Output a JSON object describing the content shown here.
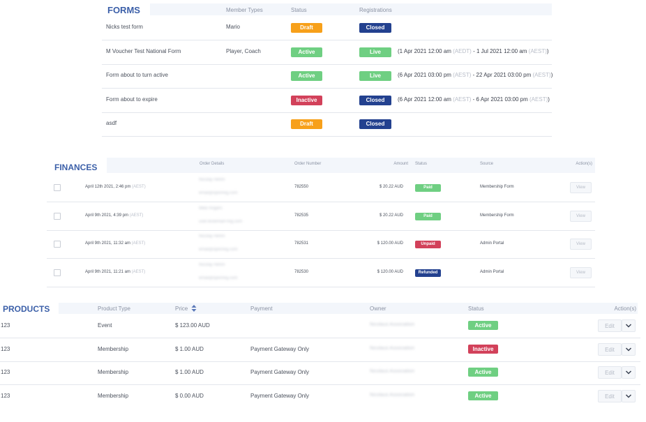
{
  "colors": {
    "accent": "#3b5fa8",
    "orange": "#f7a01a",
    "green": "#6fcf82",
    "red": "#d2415a",
    "navy": "#23418f"
  },
  "forms": {
    "title": "FORMS",
    "headers": {
      "member_types": "Member Types",
      "status": "Status",
      "registrations": "Registrations"
    },
    "rows": [
      {
        "name": "Nicks test form",
        "member_types": "Mario",
        "status": "Draft",
        "registration": "Closed",
        "range_start": "",
        "range_tz1": "",
        "range_mid": "",
        "range_tz2": "",
        "range_end": ""
      },
      {
        "name": "M Voucher Test National Form",
        "member_types": "Player, Coach",
        "status": "Active",
        "registration": "Live",
        "range_start": "(1 Apr 2021 12:00 am ",
        "range_tz1": "(AEDT)",
        "range_mid": " - 1 Jul 2021 12:00 am ",
        "range_tz2": "(AEST)",
        "range_end": ")"
      },
      {
        "name": "Form about to turn active",
        "member_types": "",
        "status": "Active",
        "registration": "Live",
        "range_start": "(6 Apr 2021 03:00 pm ",
        "range_tz1": "(AEST)",
        "range_mid": " - 22 Apr 2021 03:00 pm ",
        "range_tz2": "(AEST)",
        "range_end": ")"
      },
      {
        "name": "Form about to expire",
        "member_types": "",
        "status": "Inactive",
        "registration": "Closed",
        "range_start": "(6 Apr 2021 12:00 am ",
        "range_tz1": "(AEST)",
        "range_mid": " - 6 Apr 2021 03:00 pm ",
        "range_tz2": "(AEST)",
        "range_end": ")"
      },
      {
        "name": "asdf",
        "member_types": "",
        "status": "Draft",
        "registration": "Closed",
        "range_start": "",
        "range_tz1": "",
        "range_mid": "",
        "range_tz2": "",
        "range_end": ""
      }
    ]
  },
  "finances": {
    "title": "FINANCES",
    "headers": {
      "order_details": "Order Details",
      "order_number": "Order Number",
      "amount": "Amount",
      "status": "Status",
      "source": "Source",
      "actions": "Action(s)"
    },
    "view_label": "View",
    "rows": [
      {
        "date": "April 12th 2021, 2:46 pm ",
        "tz": "(AEST)",
        "detail_name": "Nicolay Hehm",
        "detail_email": "email@openreg.com",
        "order_number": "782550",
        "amount": "$ 20.22 AUD",
        "status": "Paid",
        "source": "Membership Form"
      },
      {
        "date": "April 9th 2021, 4:39 pm ",
        "tz": "(AEST)",
        "detail_name": "Mike Rogers",
        "detail_email": "user.testemail+reg.com",
        "order_number": "782535",
        "amount": "$ 20.22 AUD",
        "status": "Paid",
        "source": "Membership Form"
      },
      {
        "date": "April 9th 2021, 11:32 am ",
        "tz": "(AEST)",
        "detail_name": "Nicolay Hehm",
        "detail_email": "email@openreg.com",
        "order_number": "782531",
        "amount": "$ 120.00 AUD",
        "status": "Unpaid",
        "source": "Admin Portal"
      },
      {
        "date": "April 9th 2021, 11:21 am ",
        "tz": "(AEST)",
        "detail_name": "Nicolay Hehm",
        "detail_email": "email@openreg.com",
        "order_number": "782530",
        "amount": "$ 120.00 AUD",
        "status": "Refunded",
        "source": "Admin Portal"
      }
    ]
  },
  "products": {
    "title": "PRODUCTS",
    "headers": {
      "product_type": "Product Type",
      "price": "Price",
      "payment": "Payment",
      "owner": "Owner",
      "status": "Status",
      "actions": "Action(s)"
    },
    "edit_label": "Edit",
    "rows": [
      {
        "name": "123",
        "type": "Event",
        "price": "$ 123.00 AUD",
        "payment": "",
        "owner": "Nicolaus Association",
        "status": "Active"
      },
      {
        "name": "123",
        "type": "Membership",
        "price": "$ 1.00 AUD",
        "payment": "Payment Gateway Only",
        "owner": "Nicolaus Association",
        "status": "Inactive"
      },
      {
        "name": "123",
        "type": "Membership",
        "price": "$ 1.00 AUD",
        "payment": "Payment Gateway Only",
        "owner": "Nicolaus Association",
        "status": "Active"
      },
      {
        "name": "123",
        "type": "Membership",
        "price": "$ 0.00 AUD",
        "payment": "Payment Gateway Only",
        "owner": "Nicolaus Association",
        "status": "Active"
      }
    ]
  }
}
